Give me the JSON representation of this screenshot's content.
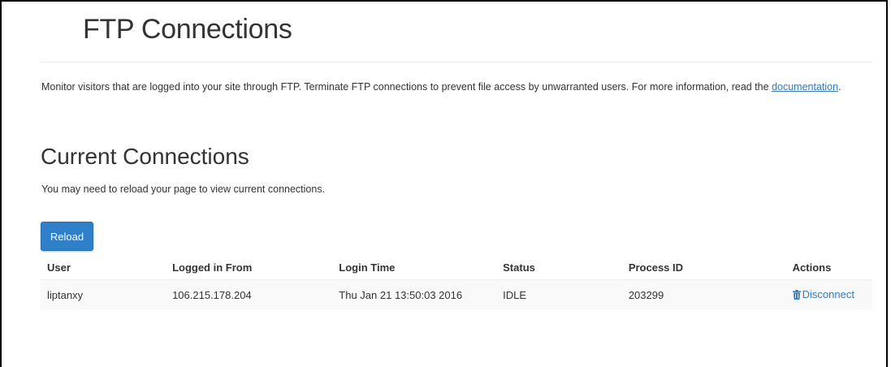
{
  "page": {
    "title": "FTP Connections",
    "description": "Monitor visitors that are logged into your site through FTP. Terminate FTP connections to prevent file access by unwarranted users. For more information, read the ",
    "doc_link": "documentation",
    "description_end": "."
  },
  "section": {
    "title": "Current Connections",
    "hint": "You may need to reload your page to view current connections.",
    "reload_label": "Reload"
  },
  "table": {
    "headers": {
      "user": "User",
      "logged_from": "Logged in From",
      "login_time": "Login Time",
      "status": "Status",
      "pid": "Process ID",
      "actions": "Actions"
    },
    "rows": [
      {
        "user": "liptanxy",
        "logged_from": "106.215.178.204",
        "login_time": "Thu Jan 21 13:50:03 2016",
        "status": "IDLE",
        "pid": "203299",
        "action_label": "Disconnect",
        "action_icon": "trash-icon"
      }
    ]
  },
  "colors": {
    "accent": "#2f80c8",
    "link": "#337ab7"
  }
}
